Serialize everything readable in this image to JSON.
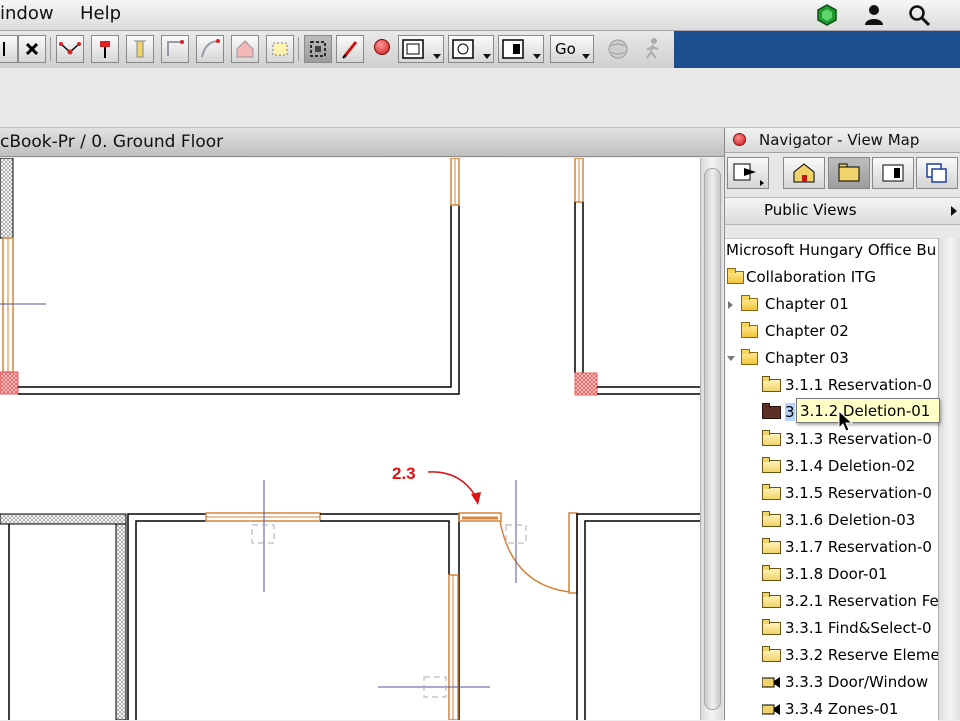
{
  "menubar": {
    "items": [
      "indow",
      "Help"
    ]
  },
  "toolbar": {
    "go_label": "Go",
    "icons": [
      "pointer-cross-icon",
      "close-x-icon",
      "node-tool-icon",
      "pin-tool-icon",
      "column-tool-icon",
      "corner-tool-icon",
      "arc-tool-icon",
      "house-tool-icon",
      "dashed-rect-icon",
      "select-frame-icon",
      "pen-tool-icon",
      "record-icon",
      "layout-dropdown-icon",
      "view-dropdown-icon",
      "window-dropdown-icon",
      "globe-icon",
      "walk-icon"
    ]
  },
  "plan": {
    "title": "cBook-Pr / 0. Ground Floor",
    "annotation_label": "2.3",
    "colors": {
      "wall": "#000000",
      "window": "#d6843c",
      "hatch": "#e85b5b",
      "guide": "#555599",
      "annotation": "#e01010"
    }
  },
  "navigator": {
    "title": "Navigator - View Map",
    "public_views": "Public Views",
    "tree": [
      {
        "label": "Microsoft Hungary Office Bu",
        "icon": "none",
        "indent": 0
      },
      {
        "label": "Collaboration ITG",
        "icon": "folder-icon",
        "indent": 0
      },
      {
        "label": "Chapter 01",
        "icon": "folder-icon",
        "indent": 1,
        "disclosure": "right"
      },
      {
        "label": "Chapter 02",
        "icon": "folder-icon",
        "indent": 1
      },
      {
        "label": "Chapter 03",
        "icon": "folder-icon",
        "indent": 1,
        "disclosure": "down"
      },
      {
        "label": "3.1.1 Reservation-0",
        "icon": "view-icon",
        "indent": 2
      },
      {
        "label": "3",
        "icon": "view-icon-dark",
        "indent": 2,
        "selected": true
      },
      {
        "label": "3.1.3 Reservation-0",
        "icon": "view-icon",
        "indent": 2
      },
      {
        "label": "3.1.4 Deletion-02",
        "icon": "view-icon",
        "indent": 2
      },
      {
        "label": "3.1.5 Reservation-0",
        "icon": "view-icon",
        "indent": 2
      },
      {
        "label": "3.1.6 Deletion-03",
        "icon": "view-icon",
        "indent": 2
      },
      {
        "label": "3.1.7 Reservation-0",
        "icon": "view-icon",
        "indent": 2
      },
      {
        "label": "3.1.8 Door-01",
        "icon": "view-icon",
        "indent": 2
      },
      {
        "label": "3.2.1 Reservation Fe",
        "icon": "view-icon",
        "indent": 2
      },
      {
        "label": "3.3.1 Find&Select-0",
        "icon": "view-icon",
        "indent": 2
      },
      {
        "label": "3.3.2 Reserve Eleme",
        "icon": "view-icon",
        "indent": 2
      },
      {
        "label": "3.3.3 Door/Window",
        "icon": "camera-icon",
        "indent": 2
      },
      {
        "label": "3.3.4 Zones-01",
        "icon": "camera-icon",
        "indent": 2
      }
    ],
    "tooltip": "3.1.2 Deletion-01"
  }
}
